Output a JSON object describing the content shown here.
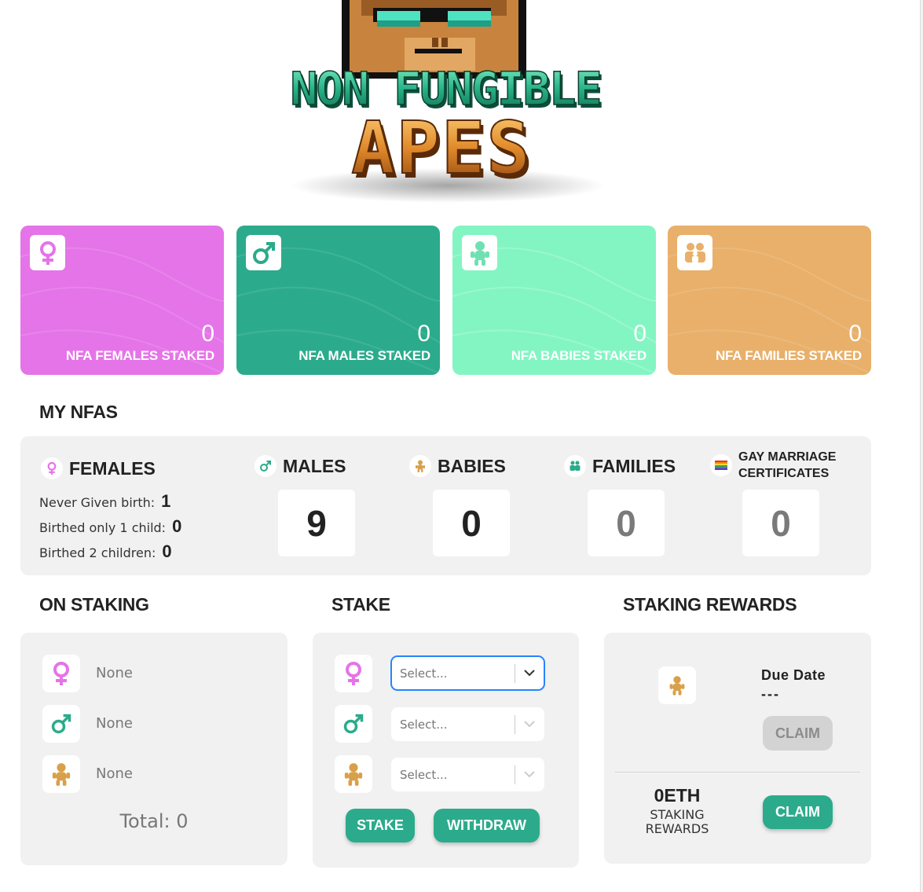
{
  "logo": {
    "line1": "NON FUNGIBLE",
    "line2": "APES"
  },
  "stat_cards": [
    {
      "key": "females",
      "count": "0",
      "label": "NFA FEMALES STAKED",
      "icon": "female-symbol-icon",
      "color": "#e574e8"
    },
    {
      "key": "males",
      "count": "0",
      "label": "NFA MALES STAKED",
      "icon": "male-symbol-icon",
      "color": "#2bab8c"
    },
    {
      "key": "babies",
      "count": "0",
      "label": "NFA BABIES STAKED",
      "icon": "baby-icon",
      "color": "#83f5c3"
    },
    {
      "key": "families",
      "count": "0",
      "label": "NFA FAMILIES STAKED",
      "icon": "family-icon",
      "color": "#e8b06a"
    }
  ],
  "my_nfas": {
    "title": "MY NFAS",
    "females": {
      "label": "FEMALES",
      "never_given_birth_label": "Never Given birth:",
      "never_given_birth_value": "1",
      "birthed_one_label": "Birthed only 1 child:",
      "birthed_one_value": "0",
      "birthed_two_label": "Birthed 2 children:",
      "birthed_two_value": "0"
    },
    "males": {
      "label": "MALES",
      "count": "9"
    },
    "babies": {
      "label": "BABIES",
      "count": "0"
    },
    "families": {
      "label": "FAMILIES",
      "count": "0"
    },
    "gay_marriage": {
      "label_line1": "GAY MARRIAGE",
      "label_line2": "CERTIFICATES",
      "count": "0"
    }
  },
  "on_staking": {
    "title": "ON STAKING",
    "female_value": "None",
    "male_value": "None",
    "baby_value": "None",
    "total": "Total: 0"
  },
  "stake": {
    "title": "STAKE",
    "female_placeholder": "Select...",
    "male_placeholder": "Select...",
    "baby_placeholder": "Select...",
    "stake_label": "STAKE",
    "withdraw_label": "WITHDRAW"
  },
  "rewards": {
    "title": "STAKING REWARDS",
    "due_date_label": "Due Date",
    "due_date_value": "---",
    "claim_baby_label": "CLAIM",
    "eth_value": "0ETH",
    "eth_label_line1": "STAKING",
    "eth_label_line2": "REWARDS",
    "claim_eth_label": "CLAIM"
  },
  "colors": {
    "female": "#e574e8",
    "male": "#2bab8c",
    "baby": "#d9a04a",
    "accent_green": "#2bab8c",
    "panel_bg": "#f1f1f1"
  }
}
